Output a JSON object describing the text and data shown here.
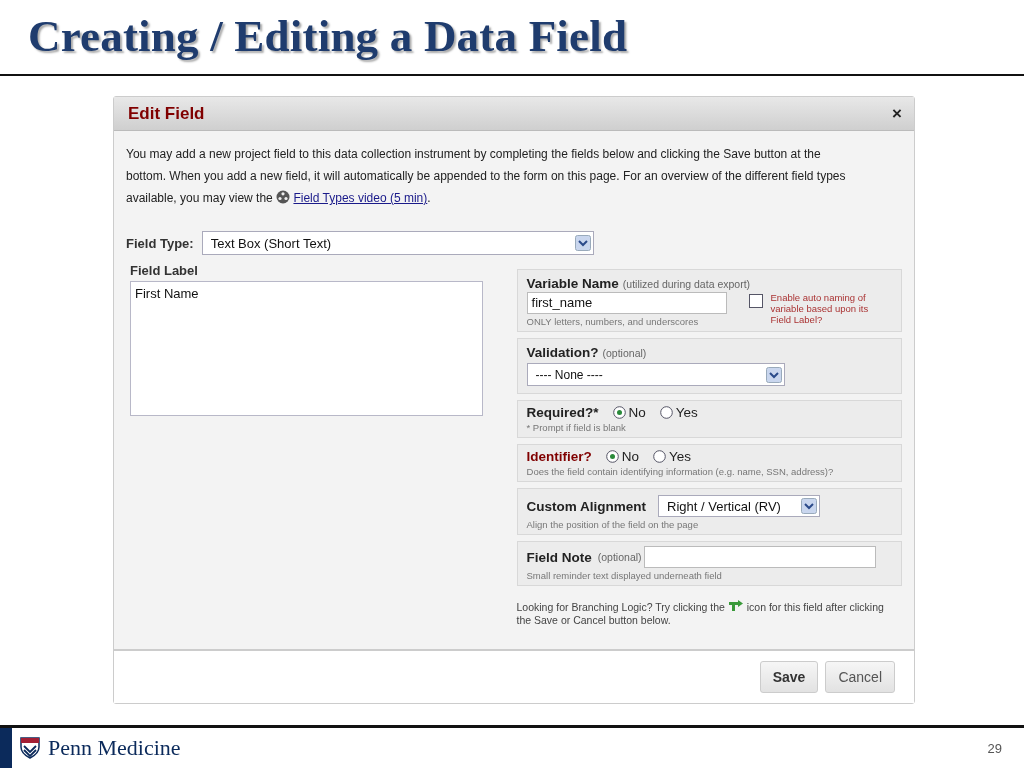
{
  "slide": {
    "title": "Creating / Editing a Data Field",
    "brand": "Penn Medicine",
    "page_number": "29"
  },
  "dialog": {
    "title": "Edit Field",
    "close": "×",
    "intro": {
      "before": "You may add a new project field to this data collection instrument by completing the fields below and clicking the Save button at the bottom. When you add a new field, it will automatically be appended to the form on this page. For an overview of the different field types available, you may view the",
      "link": "Field Types video (5 min)",
      "after": "."
    },
    "field_type": {
      "label": "Field Type:",
      "value": "Text Box (Short Text)"
    },
    "field_label": {
      "label": "Field Label",
      "value": "First Name"
    },
    "sections": [
      {
        "kind": "variable",
        "title": "Variable Name",
        "note": "(utilized during data export)",
        "value": "first_name",
        "hint": "ONLY letters, numbers, and underscores",
        "checkbox": {
          "label": "Enable auto naming of variable based upon its Field Label?",
          "checked": false
        }
      },
      {
        "kind": "select",
        "title": "Validation?",
        "note": "(optional)",
        "value": "---- None ----"
      },
      {
        "kind": "radio",
        "title": "Required?*",
        "emphasized": false,
        "options": [
          {
            "label": "No",
            "selected": true
          },
          {
            "label": "Yes",
            "selected": false
          }
        ],
        "hint": "* Prompt if field is blank"
      },
      {
        "kind": "radio",
        "title": "Identifier?",
        "emphasized": true,
        "options": [
          {
            "label": "No",
            "selected": true
          },
          {
            "label": "Yes",
            "selected": false
          }
        ],
        "hint": "Does the field contain identifying information (e.g. name, SSN, address)?"
      },
      {
        "kind": "inline_select",
        "title": "Custom Alignment",
        "value": "Right / Vertical (RV)",
        "hint": "Align the position of the field on the page"
      },
      {
        "kind": "inline_input",
        "title": "Field Note",
        "note": "(optional)",
        "hint": "Small reminder text displayed underneath field"
      }
    ],
    "branching": {
      "before": "Looking for Branching Logic? Try clicking the",
      "after": "icon for this field after clicking the Save or Cancel button below."
    },
    "buttons": [
      {
        "label": "Save",
        "kind": "primary"
      },
      {
        "label": "Cancel",
        "kind": "secondary"
      }
    ]
  }
}
